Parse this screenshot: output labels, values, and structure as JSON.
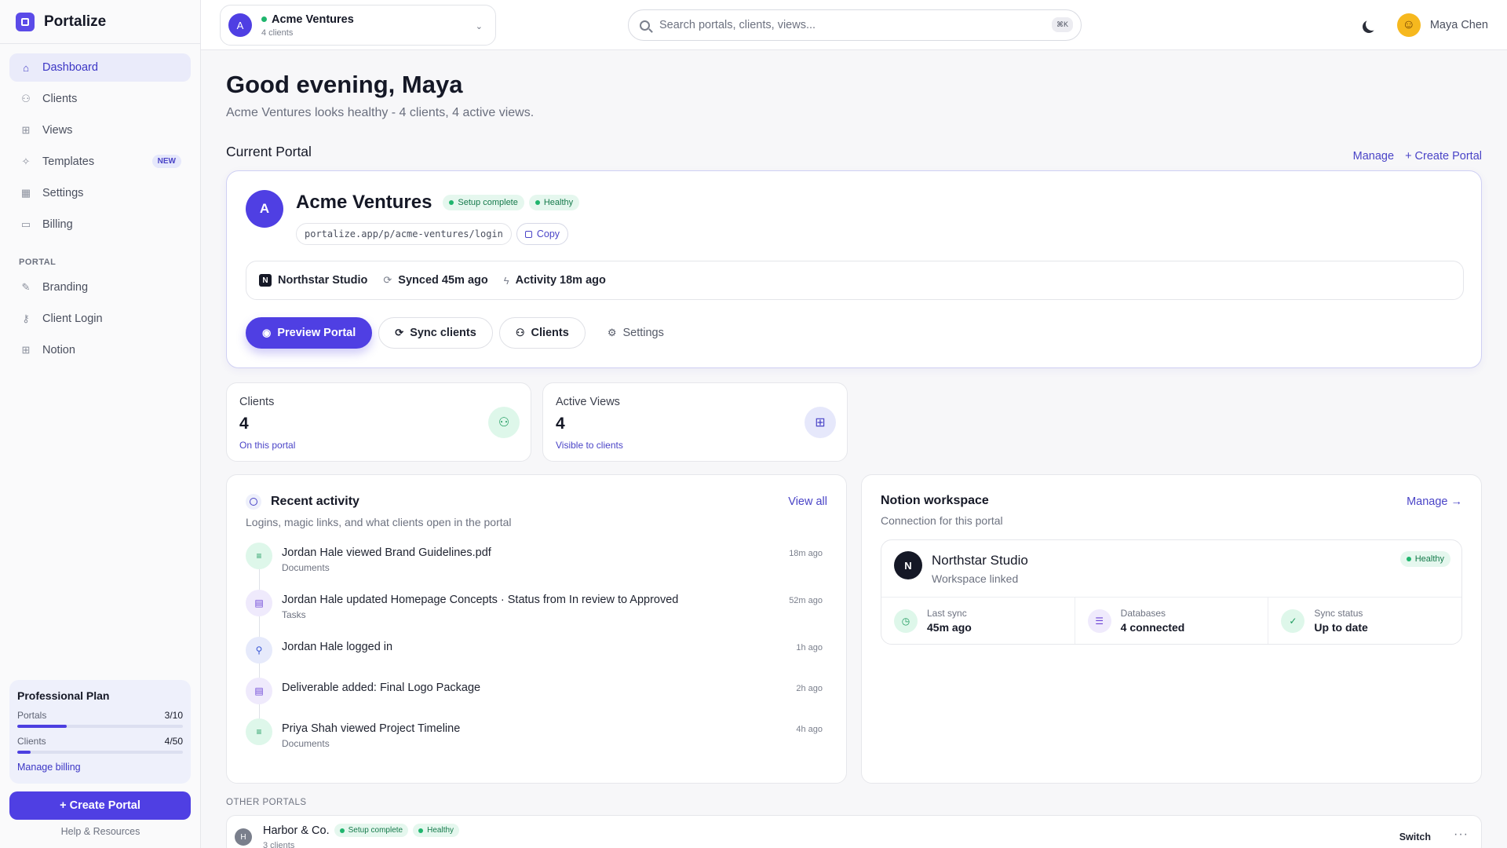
{
  "app": {
    "name": "Portalize"
  },
  "sidebar": {
    "items": [
      {
        "label": "Dashboard",
        "icon": "home-icon"
      },
      {
        "label": "Clients",
        "icon": "users-icon"
      },
      {
        "label": "Views",
        "icon": "grid-icon"
      },
      {
        "label": "Templates",
        "icon": "sparkle-icon",
        "badge": "NEW"
      },
      {
        "label": "Settings",
        "icon": "building-icon"
      },
      {
        "label": "Billing",
        "icon": "card-icon"
      }
    ],
    "portal_section": "PORTAL",
    "portal_items": [
      {
        "label": "Branding",
        "icon": "brush-icon"
      },
      {
        "label": "Client Login",
        "icon": "key-icon"
      },
      {
        "label": "Notion",
        "icon": "grid-icon"
      }
    ],
    "plan": {
      "title": "Professional Plan",
      "portals_label": "Portals",
      "portals_value": "3/10",
      "portals_fraction": 0.3,
      "clients_label": "Clients",
      "clients_value": "4/50",
      "clients_fraction": 0.08,
      "manage_billing": "Manage billing"
    },
    "create_portal": "+ Create Portal",
    "help": "Help & Resources"
  },
  "topbar": {
    "workspace": {
      "initial": "A",
      "name": "Acme Ventures",
      "sub": "4 clients"
    },
    "search": {
      "placeholder": "Search portals, clients, views...",
      "shortcut": "⌘K"
    },
    "user": {
      "name": "Maya Chen"
    }
  },
  "main": {
    "greeting": "Good evening, Maya",
    "subtitle": "Acme Ventures looks healthy - 4 clients, 4 active views.",
    "current_portal_heading": "Current Portal",
    "manage": "Manage",
    "create_portal": "+ Create Portal",
    "portal": {
      "initial": "A",
      "name": "Acme Ventures",
      "badge_setup": "Setup complete",
      "badge_health": "Healthy",
      "url": "portalize.app/p/acme-ventures/login",
      "copy": "Copy",
      "workspace": "Northstar Studio",
      "synced": "Synced 45m ago",
      "activity": "Activity 18m ago",
      "actions": {
        "preview": "Preview Portal",
        "sync": "Sync clients",
        "clients": "Clients",
        "settings": "Settings"
      }
    },
    "stats": [
      {
        "label": "Clients",
        "value": "4",
        "sub": "On this portal"
      },
      {
        "label": "Active Views",
        "value": "4",
        "sub": "Visible to clients"
      }
    ],
    "activity": {
      "title": "Recent activity",
      "sub": "Logins, magic links, and what clients open in the portal",
      "view_all": "View all",
      "items": [
        {
          "text": "Jordan Hale viewed Brand Guidelines.pdf",
          "category": "Documents",
          "time": "18m ago"
        },
        {
          "text": "Jordan Hale updated Homepage Concepts · Status from In review to Approved",
          "category": "Tasks",
          "time": "52m ago"
        },
        {
          "text": "Jordan Hale logged in",
          "category": "",
          "time": "1h ago"
        },
        {
          "text": "Deliverable added: Final Logo Package",
          "category": "",
          "time": "2h ago"
        },
        {
          "text": "Priya Shah viewed Project Timeline",
          "category": "Documents",
          "time": "4h ago"
        }
      ]
    },
    "notion": {
      "title": "Notion workspace",
      "sub": "Connection for this portal",
      "manage": "Manage →",
      "workspace_name": "Northstar Studio",
      "workspace_sub": "Workspace linked",
      "status": "Healthy",
      "stats": [
        {
          "label": "Last sync",
          "value": "45m ago"
        },
        {
          "label": "Databases",
          "value": "4 connected"
        },
        {
          "label": "Sync status",
          "value": "Up to date"
        }
      ]
    },
    "other_portals": {
      "heading": "OTHER PORTALS",
      "items": [
        {
          "initial": "H",
          "name": "Harbor & Co.",
          "badge_setup": "Setup complete",
          "badge_health": "Healthy",
          "sub": "3 clients",
          "switch": "Switch"
        }
      ]
    }
  }
}
